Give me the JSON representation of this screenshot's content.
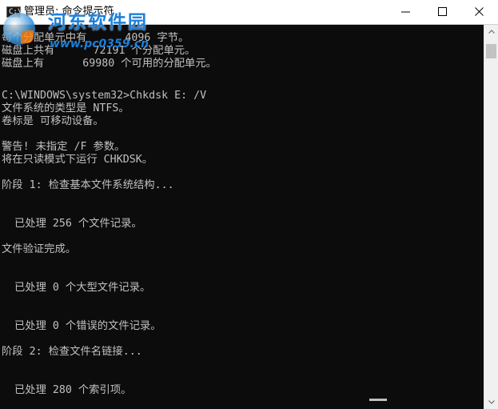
{
  "window": {
    "title": "管理员: 命令提示符",
    "icon": "cmd-icon",
    "icon_text": "C:\\"
  },
  "watermark": {
    "title": "河东软件园",
    "url": "www.pc0359.cn"
  },
  "console": {
    "lines": [
      "每个分配单元中有      4096 字节。",
      "磁盘上共有      72191 个分配单元。",
      "磁盘上有      69980 个可用的分配单元。",
      "",
      "C:\\WINDOWS\\system32>Chkdsk E: /V",
      "文件系统的类型是 NTFS。",
      "卷标是 可移动设备。",
      "",
      "警告! 未指定 /F 参数。",
      "将在只读模式下运行 CHKDSK。",
      "",
      "阶段 1: 检查基本文件系统结构...",
      "",
      "",
      "  已处理 256 个文件记录。",
      "",
      "文件验证完成。",
      "",
      "",
      "  已处理 0 个大型文件记录。",
      "",
      "",
      "  已处理 0 个错误的文件记录。",
      "",
      "阶段 2: 检查文件名链接...",
      "",
      "",
      "  已处理 280 个索引项。"
    ]
  },
  "colors": {
    "console_bg": "#0c0c0c",
    "console_fg": "#c0c0c0",
    "titlebar_bg": "#ffffff",
    "watermark": "#1d7fd8"
  }
}
